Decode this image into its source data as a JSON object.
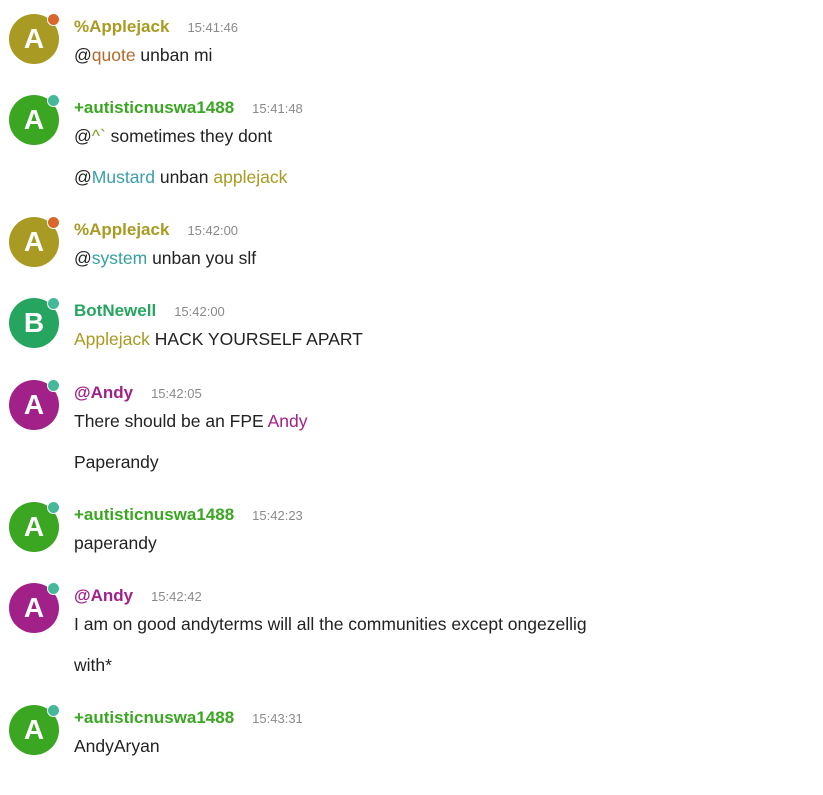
{
  "colors": {
    "applejack": "#a89a22",
    "autistic": "#3aa622",
    "botnewell": "#25a55f",
    "andy": "#a22189",
    "dot_orange": "#d9662a",
    "dot_teal": "#45b89a",
    "quote": "#b06a2a",
    "caret": "#7aa020",
    "mustard": "#3a9faa",
    "applejack_mention": "#a89a22",
    "system": "#35a0a0",
    "andy_mention": "#a22189"
  },
  "messages": [
    {
      "nick": "%Applejack",
      "time": "15:41:46",
      "avatar_letter": "A",
      "lines": [
        {
          "at": "@",
          "mention": "quote",
          "text": " unban mi"
        }
      ]
    },
    {
      "nick": "+autisticnuswa1488",
      "time": "15:41:48",
      "avatar_letter": "A",
      "lines": [
        {
          "at": "@",
          "mention": "^`",
          "text": " sometimes they dont"
        },
        {
          "at": "@",
          "mention": "Mustard",
          "text": " unban ",
          "mention2": "applejack"
        }
      ]
    },
    {
      "nick": "%Applejack",
      "time": "15:42:00",
      "avatar_letter": "A",
      "lines": [
        {
          "at": "@",
          "mention": "system",
          "text": " unban you slf"
        }
      ]
    },
    {
      "nick": "BotNewell",
      "time": "15:42:00",
      "avatar_letter": "B",
      "lines": [
        {
          "mention": "Applejack",
          "text": " HACK YOURSELF APART"
        }
      ]
    },
    {
      "nick": "@Andy",
      "time": "15:42:05",
      "avatar_letter": "A",
      "lines": [
        {
          "text": "There should be an FPE ",
          "mention": "Andy"
        },
        {
          "text": "Paperandy"
        }
      ]
    },
    {
      "nick": "+autisticnuswa1488",
      "time": "15:42:23",
      "avatar_letter": "A",
      "lines": [
        {
          "text": "paperandy"
        }
      ]
    },
    {
      "nick": "@Andy",
      "time": "15:42:42",
      "avatar_letter": "A",
      "lines": [
        {
          "text": "I am on good andyterms will all the communities except ongezellig"
        },
        {
          "text": "with*"
        }
      ]
    },
    {
      "nick": "+autisticnuswa1488",
      "time": "15:43:31",
      "avatar_letter": "A",
      "lines": [
        {
          "text": "AndyAryan"
        }
      ]
    }
  ]
}
